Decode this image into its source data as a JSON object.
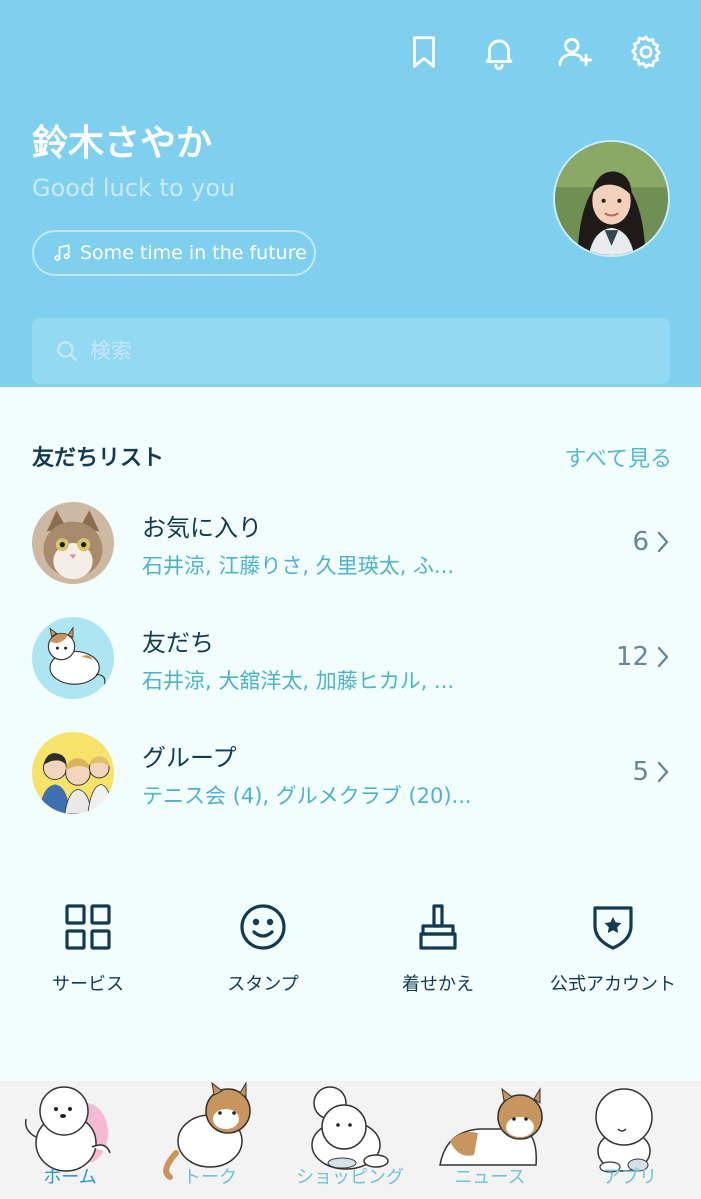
{
  "profile": {
    "name": "鈴木さやか",
    "status_message": "Good luck to you",
    "music": "Some time in the future"
  },
  "search": {
    "placeholder": "検索"
  },
  "friends_section": {
    "title": "友だちリスト",
    "see_all": "すべて見る",
    "rows": [
      {
        "title": "お気に入り",
        "subtitle": "石井涼, 江藤りさ, 久里瑛太, ふ...",
        "count": "6"
      },
      {
        "title": "友だち",
        "subtitle": "石井涼, 大舘洋太, 加藤ヒカル, ...",
        "count": "12"
      },
      {
        "title": "グループ",
        "subtitle": "テニス会 (4), グルメクラブ (20)...",
        "count": "5"
      }
    ]
  },
  "services": [
    {
      "label": "サービス",
      "icon": "grid-icon"
    },
    {
      "label": "スタンプ",
      "icon": "smiley-icon"
    },
    {
      "label": "着せかえ",
      "icon": "brush-icon"
    },
    {
      "label": "公式アカウント",
      "icon": "shield-star-icon"
    }
  ],
  "tabs": [
    {
      "label": "ホーム",
      "active": true
    },
    {
      "label": "トーク",
      "active": false
    },
    {
      "label": "ショッピング",
      "active": false
    },
    {
      "label": "ニュース",
      "active": false
    },
    {
      "label": "アプリ",
      "active": false
    }
  ],
  "colors": {
    "header_bg": "#7fd0ef",
    "body_bg": "#f2fdfd",
    "accent": "#4fb2c6",
    "text_dark": "#143a4f"
  }
}
